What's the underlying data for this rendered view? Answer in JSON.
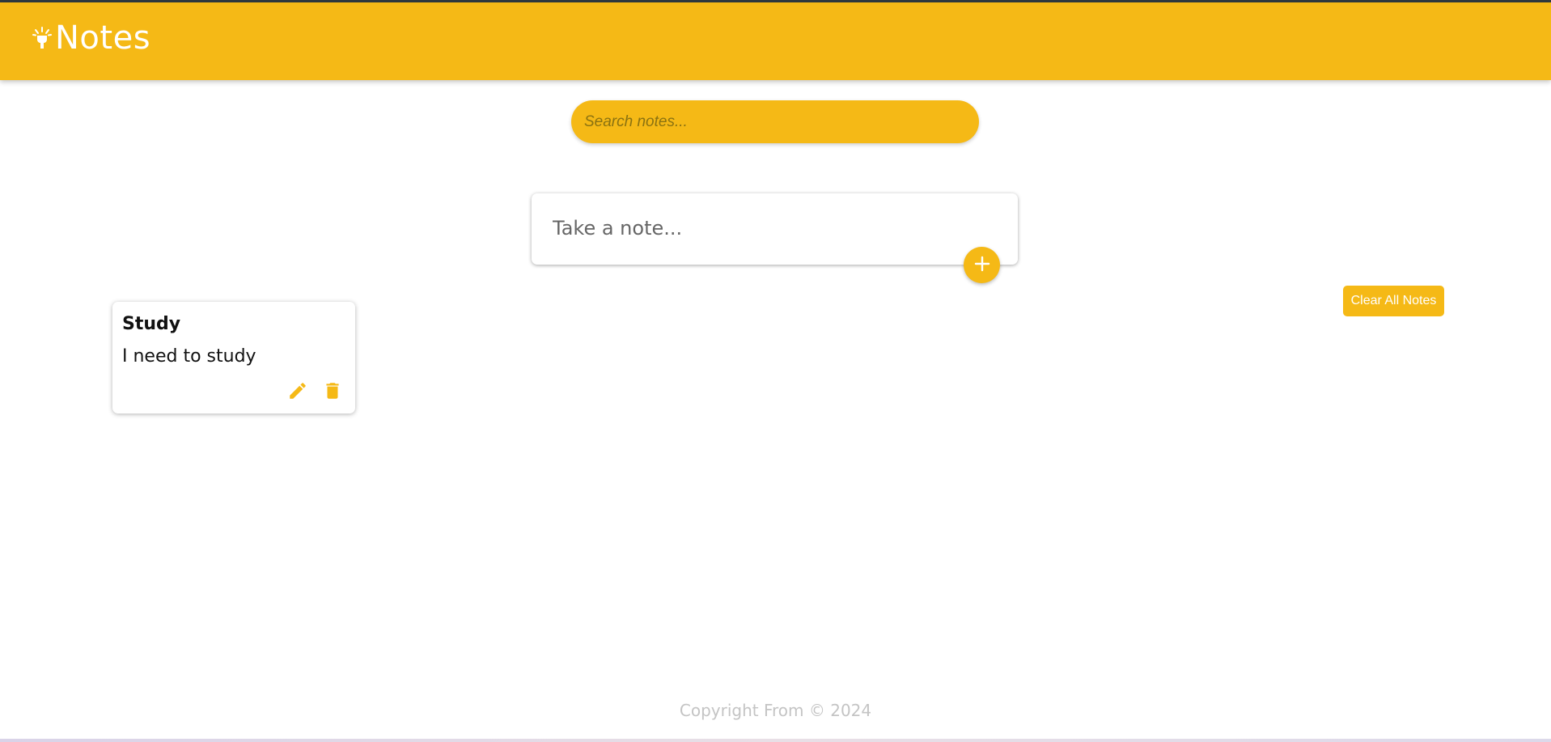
{
  "app": {
    "title": "Notes",
    "icon": "lightbulb-icon",
    "accent_color": "#f5b916"
  },
  "search": {
    "placeholder": "Search notes...",
    "value": ""
  },
  "composer": {
    "placeholder": "Take a note...",
    "value": "",
    "add_icon": "plus-icon"
  },
  "actions": {
    "clear_all_label": "Clear All Notes"
  },
  "notes": [
    {
      "title": "Study",
      "content": "I need to study",
      "edit_icon": "pencil-icon",
      "delete_icon": "trash-icon"
    }
  ],
  "footer": {
    "text": "Copyright From © 2024"
  }
}
